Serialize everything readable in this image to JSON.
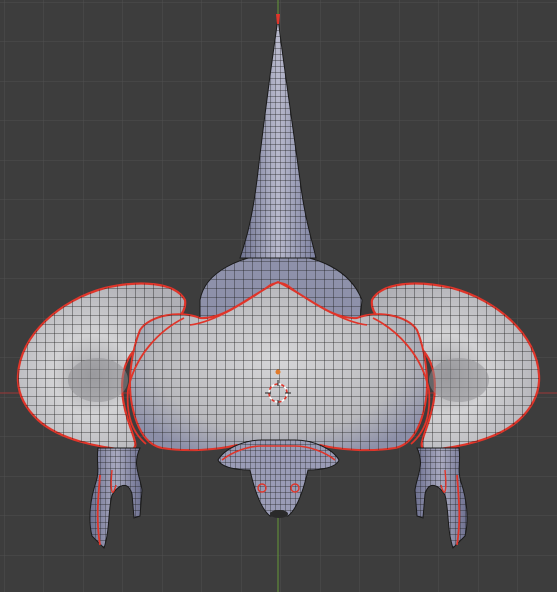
{
  "viewport": {
    "mode": "edit-mesh",
    "view": "front-orthographic",
    "colors": {
      "background": "#3d3d3d",
      "grid": "#505050",
      "axis_x": "#8a3a3a",
      "axis_z": "#5f8a3a",
      "mesh_fill": "#c8c8cc",
      "mesh_shadow": "#7b7f9a",
      "wire": "#1a1a1a",
      "seam": "#e0352a"
    },
    "icons": [
      "3d-cursor-icon",
      "pivot-dot-icon"
    ]
  }
}
